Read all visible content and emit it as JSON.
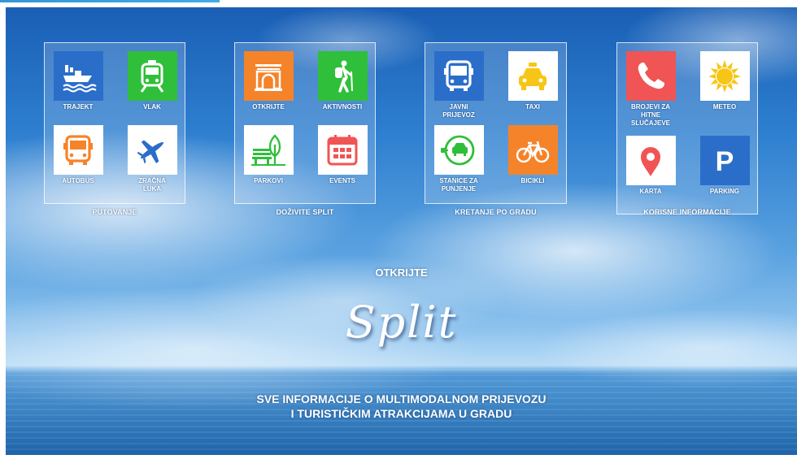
{
  "colors": {
    "blue": "#2b6ec9",
    "green": "#2fbf3a",
    "orange": "#f5832a",
    "red": "#f05454",
    "yellow": "#f7c515",
    "white": "#ffffff"
  },
  "groups": [
    {
      "label": "PUTOVANJE",
      "tiles": [
        {
          "label": "TRAJEKT",
          "icon": "ship-icon"
        },
        {
          "label": "VLAK",
          "icon": "train-icon"
        },
        {
          "label": "AUTOBUS",
          "icon": "bus-icon"
        },
        {
          "label": "ZRAČNA LUKA",
          "icon": "airplane-icon"
        }
      ]
    },
    {
      "label": "DOŽIVITE SPLIT",
      "tiles": [
        {
          "label": "OTKRIJTE",
          "icon": "monument-icon"
        },
        {
          "label": "AKTIVNOSTI",
          "icon": "hiker-icon"
        },
        {
          "label": "PARKOVI",
          "icon": "park-bench-icon"
        },
        {
          "label": "EVENTS",
          "icon": "calendar-icon"
        }
      ]
    },
    {
      "label": "KRETANJE PO GRADU",
      "tiles": [
        {
          "label": "JAVNI PRIJEVOZ",
          "icon": "city-bus-icon"
        },
        {
          "label": "TAXI",
          "icon": "taxi-icon"
        },
        {
          "label": "STANICE ZA PUNJENJE",
          "icon": "ev-charging-icon"
        },
        {
          "label": "BICIKLI",
          "icon": "bicycle-icon"
        }
      ]
    },
    {
      "label": "KORISNE INFORMACIJE",
      "tiles": [
        {
          "label": "BROJEVI ZA HITNE SLUČAJEVE",
          "icon": "phone-icon"
        },
        {
          "label": "METEO",
          "icon": "sun-icon"
        },
        {
          "label": "KARTA",
          "icon": "map-pin-icon"
        },
        {
          "label": "PARKING",
          "icon": "parking-icon"
        }
      ]
    }
  ],
  "hero": {
    "subtitle": "OTKRIJTE",
    "title": "Split",
    "desc_line1": "SVE INFORMACIJE O MULTIMODALNOM PRIJEVOZU",
    "desc_line2": "I TURISTIČKIM ATRAKCIJAMA U GRADU"
  }
}
